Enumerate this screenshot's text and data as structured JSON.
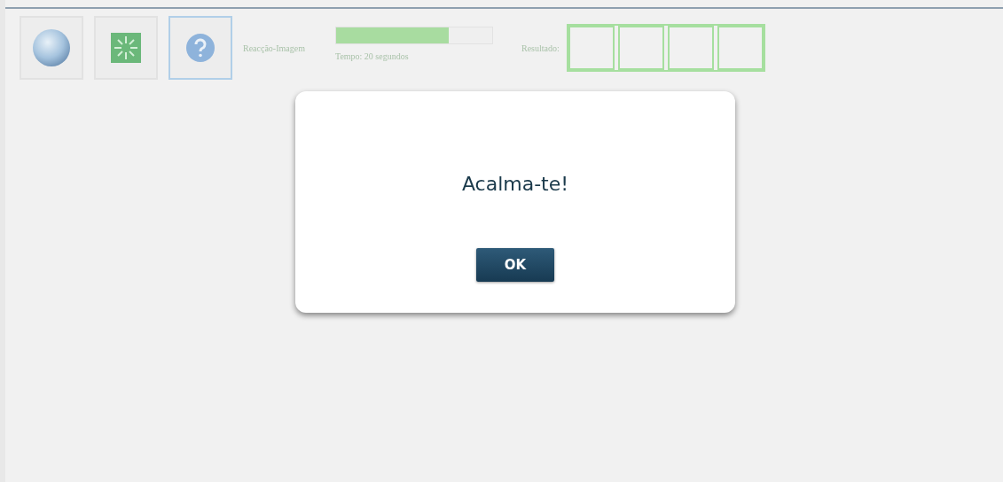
{
  "toolbar": {
    "buttons": [
      {
        "kind": "globe",
        "selected": false
      },
      {
        "kind": "puzzle",
        "selected": false
      },
      {
        "kind": "help",
        "selected": true
      }
    ],
    "mode_label": "Reacção-Imagem",
    "timer": {
      "level": 0.72,
      "caption": "Tempo: 20 segundos"
    },
    "result_label": "Resultado:",
    "result_slots": [
      {
        "filled": false
      },
      {
        "filled": false
      },
      {
        "filled": false
      },
      {
        "filled": false
      }
    ]
  },
  "dialog": {
    "message": "Acalma-te!",
    "button": "OK"
  }
}
